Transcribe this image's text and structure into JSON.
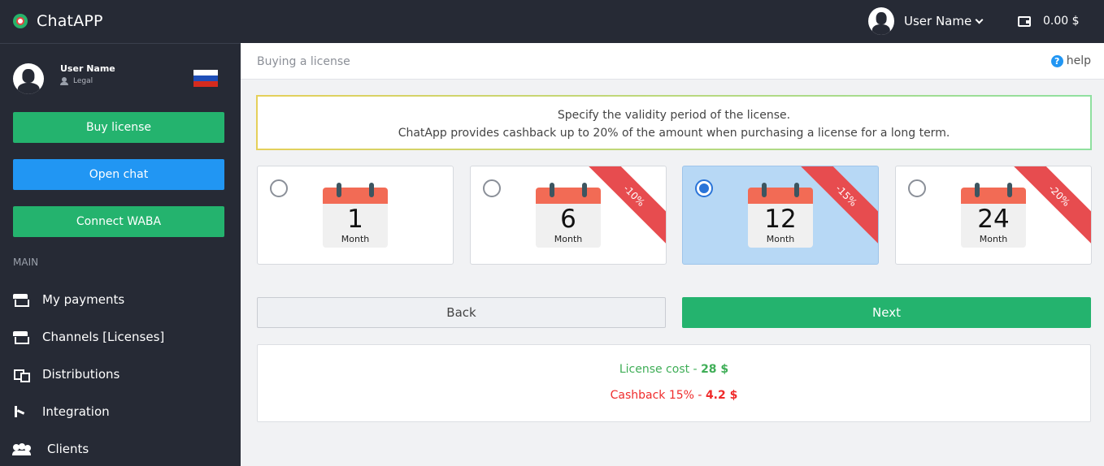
{
  "app": {
    "name": "ChatAPP"
  },
  "topbar": {
    "user_name": "User Name",
    "balance": "0.00 $"
  },
  "sidebar": {
    "user_name": "User Name",
    "user_role": "Legal",
    "flag_colors": [
      "#ffffff",
      "#1f4fb8",
      "#d52b1e"
    ],
    "buttons": {
      "buy_license": "Buy license",
      "open_chat": "Open chat",
      "connect_waba": "Connect WABA"
    },
    "section_label": "MAIN",
    "nav": [
      {
        "label": "My payments",
        "icon": "store-icon"
      },
      {
        "label": "Channels [Licenses]",
        "icon": "store-icon"
      },
      {
        "label": "Distributions",
        "icon": "distributions-icon"
      },
      {
        "label": "Integration",
        "icon": "integration-icon"
      },
      {
        "label": "Clients",
        "icon": "clients-icon"
      }
    ]
  },
  "page": {
    "title": "Buying a license",
    "help_label": "help",
    "notice_line1": "Specify the validity period of the license.",
    "notice_line2": "ChatApp provides cashback up to 20% of the amount when purchasing a license for a long term."
  },
  "plans": [
    {
      "number": "1",
      "unit": "Month",
      "discount": "",
      "selected": false
    },
    {
      "number": "6",
      "unit": "Month",
      "discount": "-10%",
      "selected": false
    },
    {
      "number": "12",
      "unit": "Month",
      "discount": "-15%",
      "selected": true
    },
    {
      "number": "24",
      "unit": "Month",
      "discount": "-20%",
      "selected": false
    }
  ],
  "actions": {
    "back": "Back",
    "next": "Next"
  },
  "summary": {
    "cost_label": "License cost - ",
    "cost_value": "28 $",
    "cashback_label": "Cashback 15% - ",
    "cashback_value": "4.2 $"
  },
  "colors": {
    "accent_green": "#24b36e",
    "accent_blue": "#2196f3",
    "sidebar_bg": "#262a35",
    "selected_plan_bg": "#b7d8f5",
    "ribbon": "#e74c4f",
    "calendar_top": "#f26b55"
  }
}
